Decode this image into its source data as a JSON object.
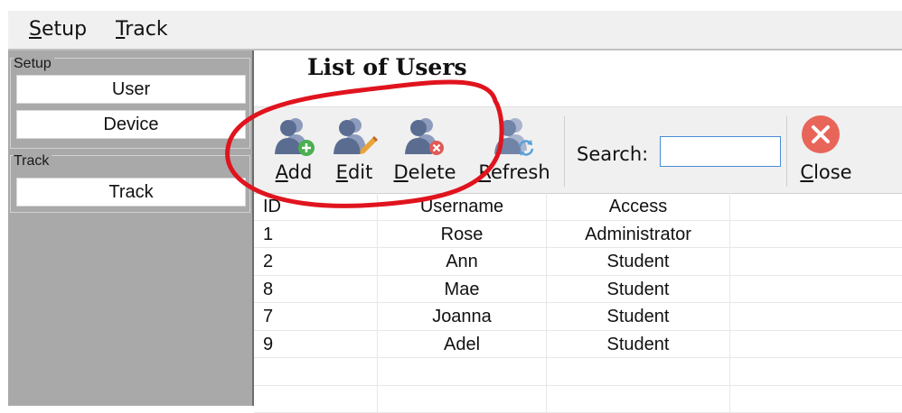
{
  "menu": {
    "items": [
      "Setup",
      "Track"
    ]
  },
  "sidebar": {
    "setup_group": {
      "title": "Setup",
      "buttons": [
        "User",
        "Device"
      ]
    },
    "track_group": {
      "title": "Track",
      "buttons": [
        "Track"
      ]
    }
  },
  "main": {
    "title": "List of Users",
    "toolbar": {
      "add": "Add",
      "edit": "Edit",
      "delete": "Delete",
      "refresh": "Refresh",
      "search_label": "Search:",
      "search_value": "",
      "close": "Close"
    },
    "table": {
      "columns": [
        "ID",
        "Username",
        "Access"
      ],
      "rows": [
        [
          "1",
          "Rose",
          "Administrator"
        ],
        [
          "2",
          "Ann",
          "Student"
        ],
        [
          "8",
          "Mae",
          "Student"
        ],
        [
          "7",
          "Joanna",
          "Student"
        ],
        [
          "9",
          "Adel",
          "Student"
        ]
      ]
    }
  },
  "colors": {
    "user_icon": "#5a6d91",
    "add_badge": "#4caf50",
    "delete_badge": "#e05a55",
    "close_button": "#e8655a",
    "annotation": "#e0141e",
    "sidebar_bg": "#a9a9a9"
  },
  "icons": [
    "user-add-icon",
    "user-edit-icon",
    "user-delete-icon",
    "user-refresh-icon",
    "close-circle-icon"
  ]
}
